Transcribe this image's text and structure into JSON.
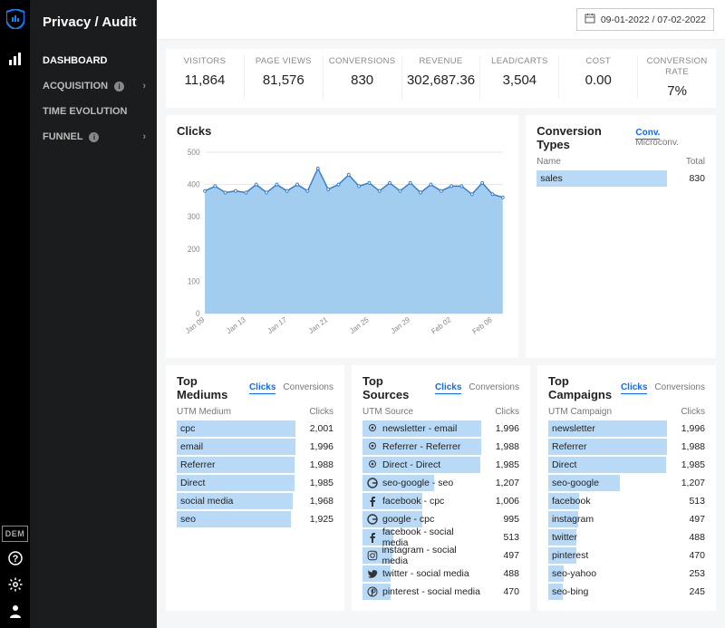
{
  "page_title": "Privacy / Audit",
  "date_range": "09-01-2022 / 07-02-2022",
  "rail": {
    "dem": "DEM"
  },
  "nav": [
    {
      "label": "DASHBOARD",
      "active": true,
      "info": false,
      "chevron": false
    },
    {
      "label": "ACQUISITION",
      "active": false,
      "info": true,
      "chevron": true
    },
    {
      "label": "TIME EVOLUTION",
      "active": false,
      "info": false,
      "chevron": false
    },
    {
      "label": "FUNNEL",
      "active": false,
      "info": true,
      "chevron": true
    }
  ],
  "stats": [
    {
      "label": "VISITORS",
      "value": "11,864"
    },
    {
      "label": "PAGE VIEWS",
      "value": "81,576"
    },
    {
      "label": "CONVERSIONS",
      "value": "830"
    },
    {
      "label": "REVENUE",
      "value": "302,687.36"
    },
    {
      "label": "LEAD/CARTS",
      "value": "3,504"
    },
    {
      "label": "COST",
      "value": "0.00"
    },
    {
      "label": "CONVERSION RATE",
      "value": "7%"
    }
  ],
  "chart_data": {
    "type": "area",
    "title": "Clicks",
    "ylabel": "",
    "xlabel": "",
    "ylim": [
      0,
      500
    ],
    "yticks": [
      0,
      100,
      200,
      300,
      400,
      500
    ],
    "categories": [
      "Jan 09",
      "Jan 10",
      "Jan 11",
      "Jan 12",
      "Jan 13",
      "Jan 14",
      "Jan 15",
      "Jan 16",
      "Jan 17",
      "Jan 18",
      "Jan 19",
      "Jan 20",
      "Jan 21",
      "Jan 22",
      "Jan 23",
      "Jan 24",
      "Jan 25",
      "Jan 26",
      "Jan 27",
      "Jan 28",
      "Jan 29",
      "Jan 30",
      "Jan 31",
      "Feb 01",
      "Feb 02",
      "Feb 03",
      "Feb 04",
      "Feb 05",
      "Feb 06",
      "Feb 07"
    ],
    "xticks": [
      "Jan 09",
      "Jan 13",
      "Jan 17",
      "Jan 21",
      "Jan 25",
      "Jan 29",
      "Feb 02",
      "Feb 06"
    ],
    "values": [
      380,
      395,
      375,
      380,
      375,
      400,
      375,
      400,
      380,
      400,
      380,
      450,
      385,
      400,
      430,
      395,
      405,
      380,
      405,
      380,
      405,
      375,
      400,
      380,
      395,
      395,
      370,
      405,
      370,
      360
    ]
  },
  "conversion_types": {
    "title": "Conversion Types",
    "tabs": {
      "active": "Conv.",
      "other": "Microconv."
    },
    "head_name": "Name",
    "head_total": "Total",
    "rows": [
      {
        "name": "sales",
        "total": "830",
        "pct": 100
      }
    ]
  },
  "top_mediums": {
    "title": "Top Mediums",
    "tabs": {
      "active": "Clicks",
      "other": "Conversions"
    },
    "head_name": "UTM Medium",
    "head_val": "Clicks",
    "max": 2001,
    "rows": [
      {
        "label": "cpc",
        "value": "2,001",
        "n": 2001
      },
      {
        "label": "email",
        "value": "1,996",
        "n": 1996
      },
      {
        "label": "Referrer",
        "value": "1,988",
        "n": 1988
      },
      {
        "label": "Direct",
        "value": "1,985",
        "n": 1985
      },
      {
        "label": "social media",
        "value": "1,968",
        "n": 1968
      },
      {
        "label": "seo",
        "value": "1,925",
        "n": 1925
      }
    ]
  },
  "top_sources": {
    "title": "Top Sources",
    "tabs": {
      "active": "Clicks",
      "other": "Conversions"
    },
    "head_name": "UTM Source",
    "head_val": "Clicks",
    "max": 1996,
    "rows": [
      {
        "icon": "pin",
        "label": "newsletter - email",
        "value": "1,996",
        "n": 1996
      },
      {
        "icon": "pin",
        "label": "Referrer - Referrer",
        "value": "1,988",
        "n": 1988
      },
      {
        "icon": "pin",
        "label": "Direct - Direct",
        "value": "1,985",
        "n": 1985
      },
      {
        "icon": "google",
        "label": "seo-google - seo",
        "value": "1,207",
        "n": 1207
      },
      {
        "icon": "facebook",
        "label": "facebook - cpc",
        "value": "1,006",
        "n": 1006
      },
      {
        "icon": "google",
        "label": "google - cpc",
        "value": "995",
        "n": 995
      },
      {
        "icon": "facebook",
        "label": "facebook - social media",
        "value": "513",
        "n": 513
      },
      {
        "icon": "instagram",
        "label": "instagram - social media",
        "value": "497",
        "n": 497
      },
      {
        "icon": "twitter",
        "label": "twitter - social media",
        "value": "488",
        "n": 488
      },
      {
        "icon": "pinterest",
        "label": "pinterest - social media",
        "value": "470",
        "n": 470
      }
    ]
  },
  "top_campaigns": {
    "title": "Top Campaigns",
    "tabs": {
      "active": "Clicks",
      "other": "Conversions"
    },
    "head_name": "UTM Campaign",
    "head_val": "Clicks",
    "max": 1996,
    "rows": [
      {
        "label": "newsletter",
        "value": "1,996",
        "n": 1996
      },
      {
        "label": "Referrer",
        "value": "1,988",
        "n": 1988
      },
      {
        "label": "Direct",
        "value": "1,985",
        "n": 1985
      },
      {
        "label": "seo-google",
        "value": "1,207",
        "n": 1207
      },
      {
        "label": "facebook",
        "value": "513",
        "n": 513
      },
      {
        "label": "instagram",
        "value": "497",
        "n": 497
      },
      {
        "label": "twitter",
        "value": "488",
        "n": 488
      },
      {
        "label": "pinterest",
        "value": "470",
        "n": 470
      },
      {
        "label": "seo-yahoo",
        "value": "253",
        "n": 253
      },
      {
        "label": "seo-bing",
        "value": "245",
        "n": 245
      }
    ]
  }
}
